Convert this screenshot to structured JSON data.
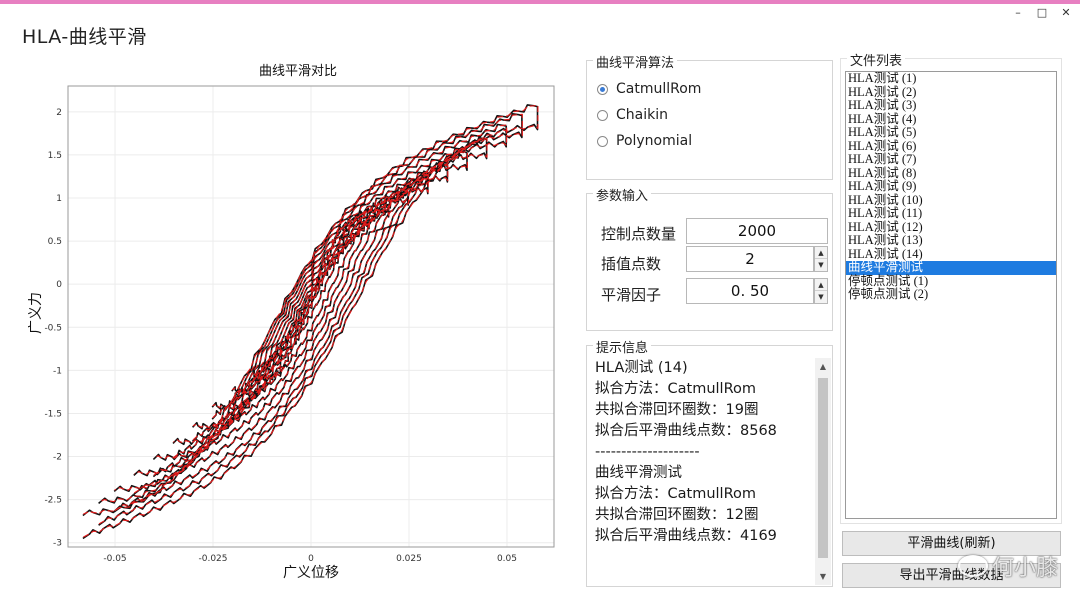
{
  "window": {
    "title": "HLA-曲线平滑",
    "controls": [
      "–",
      "□",
      "✕"
    ]
  },
  "chart_data": {
    "type": "line",
    "title": "曲线平滑对比",
    "xlabel": "广义位移",
    "ylabel": "广义力",
    "xlim": [
      -0.062,
      0.062
    ],
    "ylim": [
      -3.05,
      2.3
    ],
    "xticks": [
      -0.05,
      -0.025,
      0,
      0.025,
      0.05
    ],
    "xtick_labels": [
      "-0.05",
      "-0.025",
      "0",
      "0.025",
      "0.05"
    ],
    "yticks": [
      2,
      1.5,
      1,
      0.5,
      0,
      -0.5,
      -1,
      -1.5,
      -2,
      -2.5,
      -3
    ],
    "ytick_labels": [
      "2",
      "1.5",
      "1",
      "0.5",
      "0",
      "-0.5",
      "-1",
      "-1.5",
      "-2",
      "-2.5",
      "-3"
    ],
    "grid": true,
    "series": [
      {
        "color": "#111111",
        "loops": [
          {
            "amp": 0.058,
            "top": 2.02,
            "bot": -2.85
          },
          {
            "amp": 0.054,
            "top": 1.92,
            "bot": -2.7
          },
          {
            "amp": 0.05,
            "top": 1.8,
            "bot": -2.55
          },
          {
            "amp": 0.045,
            "top": 1.65,
            "bot": -2.35
          },
          {
            "amp": 0.04,
            "top": 1.5,
            "bot": -2.15
          },
          {
            "amp": 0.035,
            "top": 1.35,
            "bot": -1.95
          },
          {
            "amp": 0.03,
            "top": 1.2,
            "bot": -1.75
          },
          {
            "amp": 0.025,
            "top": 1.05,
            "bot": -1.5
          },
          {
            "amp": 0.02,
            "top": 0.9,
            "bot": -1.3
          },
          {
            "amp": 0.015,
            "top": 0.75,
            "bot": -1.1
          }
        ]
      },
      {
        "color": "#e01b1b",
        "loops": [
          {
            "amp": 0.058,
            "top": 2.02,
            "bot": -2.85
          },
          {
            "amp": 0.054,
            "top": 1.92,
            "bot": -2.7
          },
          {
            "amp": 0.05,
            "top": 1.8,
            "bot": -2.55
          },
          {
            "amp": 0.045,
            "top": 1.65,
            "bot": -2.35
          },
          {
            "amp": 0.04,
            "top": 1.5,
            "bot": -2.15
          },
          {
            "amp": 0.035,
            "top": 1.35,
            "bot": -1.95
          },
          {
            "amp": 0.03,
            "top": 1.2,
            "bot": -1.75
          },
          {
            "amp": 0.025,
            "top": 1.05,
            "bot": -1.5
          },
          {
            "amp": 0.02,
            "top": 0.9,
            "bot": -1.3
          },
          {
            "amp": 0.015,
            "top": 0.75,
            "bot": -1.1
          }
        ]
      }
    ]
  },
  "algorithm": {
    "title": "曲线平滑算法",
    "options": [
      {
        "label": "CatmullRom",
        "checked": true
      },
      {
        "label": "Chaikin",
        "checked": false
      },
      {
        "label": "Polynomial",
        "checked": false
      }
    ]
  },
  "params": {
    "title": "参数输入",
    "control_points_label": "控制点数量",
    "control_points_value": "2000",
    "interp_points_label": "插值点数",
    "interp_points_value": "2",
    "smooth_factor_label": "平滑因子",
    "smooth_factor_value": "0. 50"
  },
  "messages": {
    "title": "提示信息",
    "lines": [
      "HLA测试 (14)",
      "拟合方法：CatmullRom",
      "共拟合滞回环圈数：19圈",
      "拟合后平滑曲线点数：8568",
      "--------------------",
      "曲线平滑测试",
      "拟合方法：CatmullRom",
      "共拟合滞回环圈数：12圈",
      "拟合后平滑曲线点数：4169"
    ]
  },
  "files": {
    "title": "文件列表",
    "items": [
      "HLA测试 (1)",
      "HLA测试 (2)",
      "HLA测试 (3)",
      "HLA测试 (4)",
      "HLA测试 (5)",
      "HLA测试 (6)",
      "HLA测试 (7)",
      "HLA测试 (8)",
      "HLA测试 (9)",
      "HLA测试 (10)",
      "HLA测试 (11)",
      "HLA测试 (12)",
      "HLA测试 (13)",
      "HLA测试 (14)",
      "曲线平滑测试",
      "停顿点测试 (1)",
      "停顿点测试 (2)"
    ],
    "selected_index": 14
  },
  "buttons": {
    "smooth": "平滑曲线(刷新)",
    "export": "导出平滑曲线数据"
  },
  "watermark": "何小膝"
}
